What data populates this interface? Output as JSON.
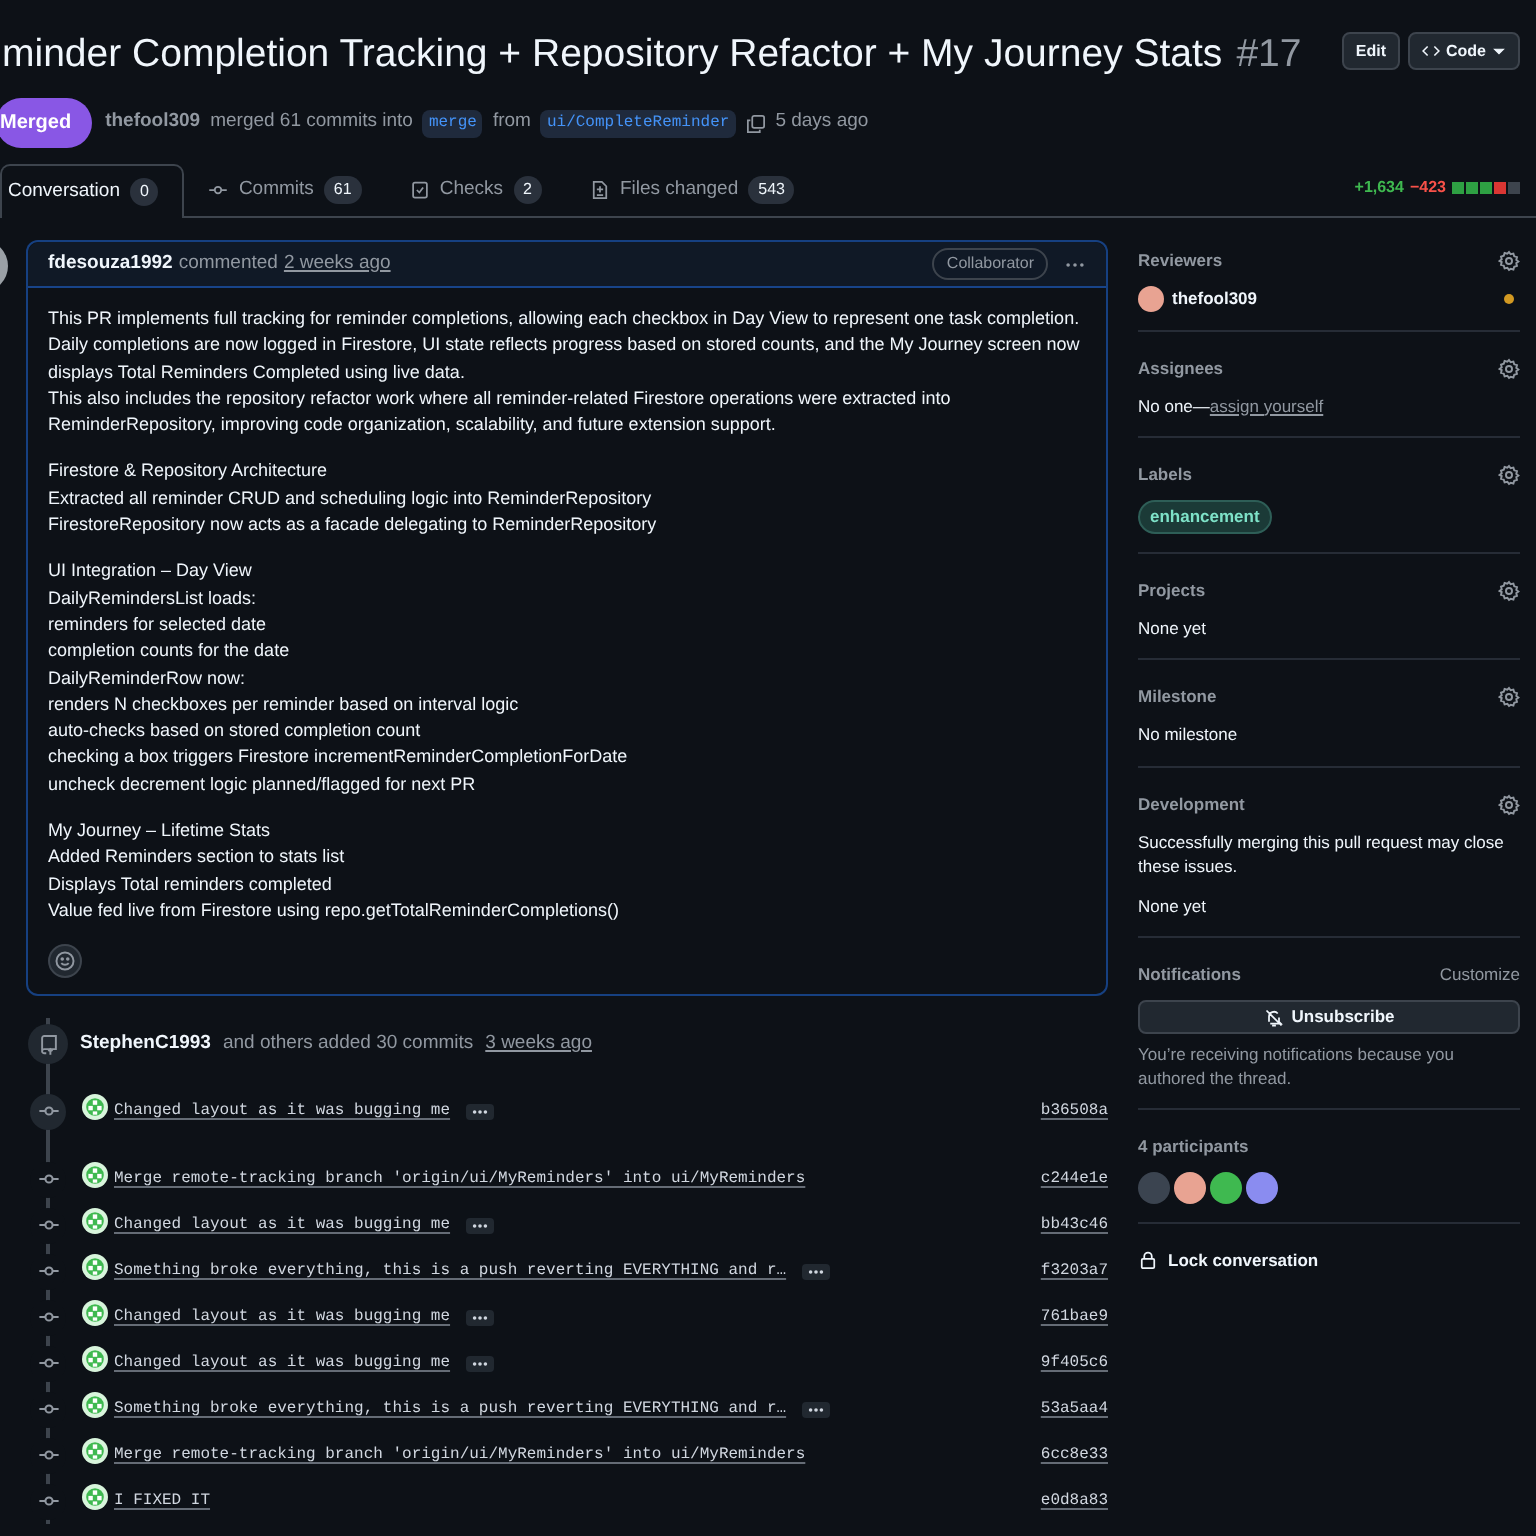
{
  "title": "minder Completion Tracking + Repository Refactor + My Journey Stats",
  "number": "#17",
  "header_buttons": [
    {
      "label": "Edit",
      "kind": "plain"
    },
    {
      "label": "Code",
      "kind": "code"
    }
  ],
  "state_badge": "Merged",
  "meta": {
    "author": "thefool309",
    "text1": "merged 61 commits into",
    "base": "merge",
    "text2": "from",
    "head": "ui/CompleteReminder",
    "time": "5 days ago"
  },
  "tabs": [
    {
      "label": "Conversation",
      "count": "0",
      "selected": true,
      "kind": "conversation"
    },
    {
      "label": "Commits",
      "count": "61",
      "selected": false,
      "kind": "commits"
    },
    {
      "label": "Checks",
      "count": "2",
      "selected": false,
      "kind": "checks"
    },
    {
      "label": "Files changed",
      "count": "543",
      "selected": false,
      "kind": "files"
    }
  ],
  "diffstat": {
    "added": "+1,634",
    "removed": "−423",
    "blocks": [
      {
        "color": "#2ea043"
      },
      {
        "color": "#2ea043"
      },
      {
        "color": "#2ea043"
      },
      {
        "color": "#da3633"
      },
      {
        "color": "#3d444d"
      }
    ]
  },
  "comment": {
    "author": "fdesouza1992",
    "action": "commented",
    "time": "2 weeks ago",
    "role": "Collaborator",
    "paragraphs": [
      [
        "This PR implements full tracking for reminder completions, allowing each checkbox in Day View to represent one task completion. Daily completions are now logged in Firestore, UI state reflects progress based on stored counts, and the My Journey screen now displays Total Reminders Completed using live data.",
        "This also includes the repository refactor work where all reminder-related Firestore operations were extracted into ReminderRepository, improving code organization, scalability, and future extension support."
      ],
      [
        "Firestore & Repository Architecture",
        "Extracted all reminder CRUD and scheduling logic into ReminderRepository",
        "FirestoreRepository now acts as a facade delegating to ReminderRepository"
      ],
      [
        "UI Integration – Day View",
        "DailyRemindersList loads:",
        "reminders for selected date",
        "completion counts for the date",
        "DailyReminderRow now:",
        "renders N checkboxes per reminder based on interval logic",
        "auto-checks based on stored completion count",
        "checking a box triggers Firestore incrementReminderCompletionForDate",
        "uncheck decrement logic planned/flagged for next PR"
      ],
      [
        "My Journey – Lifetime Stats",
        "Added Reminders section to stats list",
        "Displays Total reminders completed",
        "Value fed live from Firestore using repo.getTotalReminderCompletions()"
      ]
    ]
  },
  "push_event": {
    "author": "StephenC1993",
    "text": "and others added 30 commits",
    "time": "3 weeks ago"
  },
  "commits": [
    {
      "message": "Changed layout as it was bugging me",
      "has_more": true,
      "hash": "b36508a",
      "highlighted": true
    },
    {
      "message": "Merge remote-tracking branch 'origin/ui/MyReminders' into ui/MyReminders",
      "has_more": false,
      "hash": "c244e1e",
      "highlighted": false
    },
    {
      "message": "Changed layout as it was bugging me",
      "has_more": true,
      "hash": "bb43c46",
      "highlighted": false
    },
    {
      "message": "Something broke everything, this is a push reverting EVERYTHING and r…",
      "has_more": true,
      "hash": "f3203a7",
      "highlighted": false
    },
    {
      "message": "Changed layout as it was bugging me",
      "has_more": true,
      "hash": "761bae9",
      "highlighted": false
    },
    {
      "message": "Changed layout as it was bugging me",
      "has_more": true,
      "hash": "9f405c6",
      "highlighted": false
    },
    {
      "message": "Something broke everything, this is a push reverting EVERYTHING and r…",
      "has_more": true,
      "hash": "53a5aa4",
      "highlighted": false
    },
    {
      "message": "Merge remote-tracking branch 'origin/ui/MyReminders' into ui/MyReminders",
      "has_more": false,
      "hash": "6cc8e33",
      "highlighted": false
    },
    {
      "message": "I FIXED IT",
      "has_more": false,
      "hash": "e0d8a83",
      "highlighted": false
    }
  ],
  "sidebar": [
    {
      "kind": "reviewers",
      "heading": "Reviewers",
      "reviewer": "thefool309"
    },
    {
      "kind": "assignees",
      "heading": "Assignees",
      "text": "No one—",
      "link": "assign yourself"
    },
    {
      "kind": "labels",
      "heading": "Labels",
      "label": "enhancement"
    },
    {
      "kind": "plain",
      "heading": "Projects",
      "text": "None yet"
    },
    {
      "kind": "plain",
      "heading": "Milestone",
      "text": "No milestone"
    },
    {
      "kind": "development",
      "heading": "Development",
      "text": "Successfully merging this pull request may close these issues.",
      "note": "None yet"
    },
    {
      "kind": "notifications",
      "heading": "Notifications",
      "action": "Customize",
      "button": "Unsubscribe",
      "text": "You’re receiving notifications because you authored the thread."
    },
    {
      "kind": "participants",
      "heading": "4 participants",
      "avatars": [
        {
          "color": "#3b4450"
        },
        {
          "color": "#e8a392"
        },
        {
          "color": "#3fb950"
        },
        {
          "color": "#8a8cf0"
        }
      ]
    },
    {
      "kind": "lock",
      "text": "Lock conversation"
    }
  ]
}
